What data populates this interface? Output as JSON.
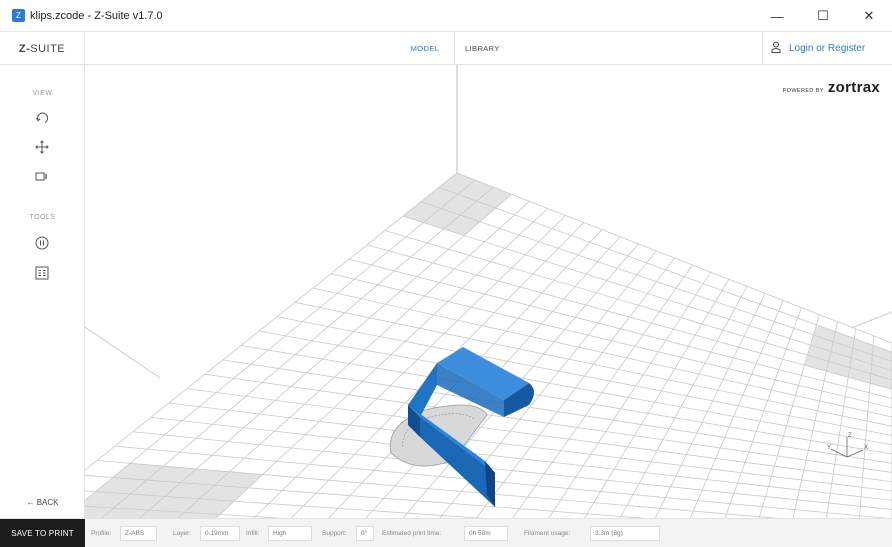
{
  "window": {
    "title": "klips.zcode - Z-Suite v1.7.0",
    "icon": "app-icon",
    "controls": {
      "minimize": "—",
      "maximize": "☐",
      "close": "✕"
    }
  },
  "header": {
    "logo_prefix": "Z-",
    "logo_suffix": "SUITE",
    "tabs": [
      {
        "label": "MODEL",
        "active": true
      },
      {
        "label": "LIBRARY",
        "active": false
      }
    ],
    "login_label": "Login or Register"
  },
  "sidebar": {
    "view_label": "VIEW",
    "tools_label": "TOOLS",
    "view_tools": [
      "rotate-icon",
      "move-icon",
      "camera-icon"
    ],
    "tools": [
      "pause-icon",
      "layers-icon"
    ],
    "back_label": "← BACK"
  },
  "viewport": {
    "powered_small": "POWERED BY",
    "powered_brand": "zortrax",
    "model_color": "#1f74c6",
    "platform_color": "#ffffff",
    "grid_line_color": "#c9c9c9",
    "highlight_tile_color": "#e3e3e3"
  },
  "bottombar": {
    "save_label": "SAVE TO PRINT",
    "fields": [
      {
        "label": "Profile:",
        "value": "Z-ABS"
      },
      {
        "label": "Layer:",
        "value": "0.19mm"
      },
      {
        "label": "Infill:",
        "value": "High"
      },
      {
        "label": "Support:",
        "value": "0°"
      },
      {
        "label": "Estimated print time:",
        "value": "0h 50m"
      },
      {
        "label": "Filament usage:",
        "value": "3.3m (8g)"
      }
    ]
  },
  "accent_color": "#2f7bd0"
}
